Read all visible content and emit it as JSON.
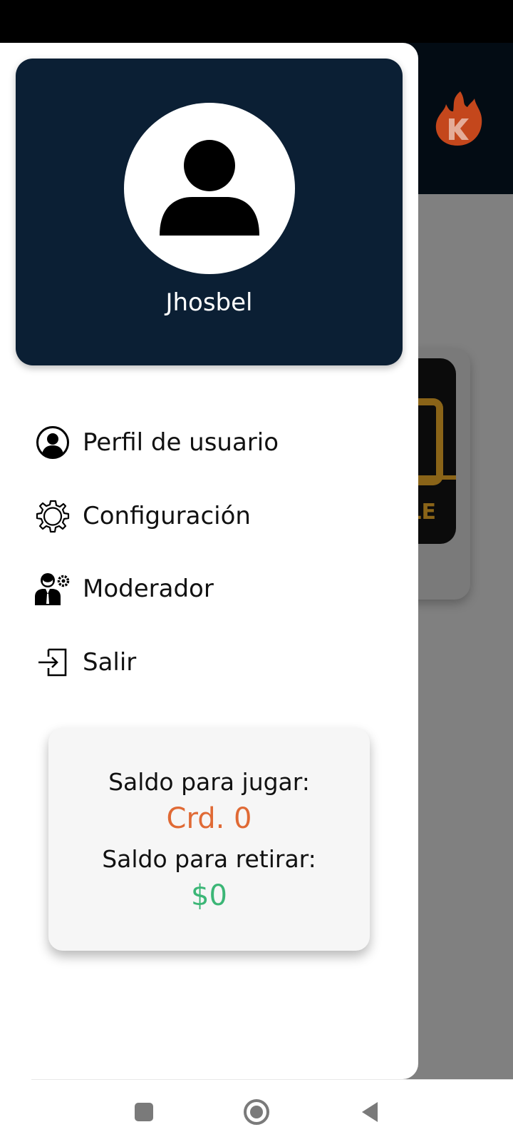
{
  "drawer": {
    "user_name": "Jhosbel",
    "menu_items": [
      {
        "label": "Perfil de usuario",
        "icon": "user-circle-icon"
      },
      {
        "label": "Configuración",
        "icon": "gear-icon"
      },
      {
        "label": "Moderador",
        "icon": "moderator-icon"
      },
      {
        "label": "Salir",
        "icon": "logout-icon"
      }
    ],
    "balance": {
      "play_label": "Saldo para jugar:",
      "play_value": "Crd. 0",
      "withdraw_label": "Saldo para retirar:",
      "withdraw_value": "$0"
    }
  },
  "background_app": {
    "game_card_text": "LE"
  },
  "colors": {
    "profile_bg": "#0b1f34",
    "play_value": "#e06a35",
    "withdraw_value": "#3bb676",
    "logo_orange": "#c4471c"
  },
  "nav": {
    "buttons": [
      "recents-button",
      "home-button",
      "back-button"
    ]
  }
}
